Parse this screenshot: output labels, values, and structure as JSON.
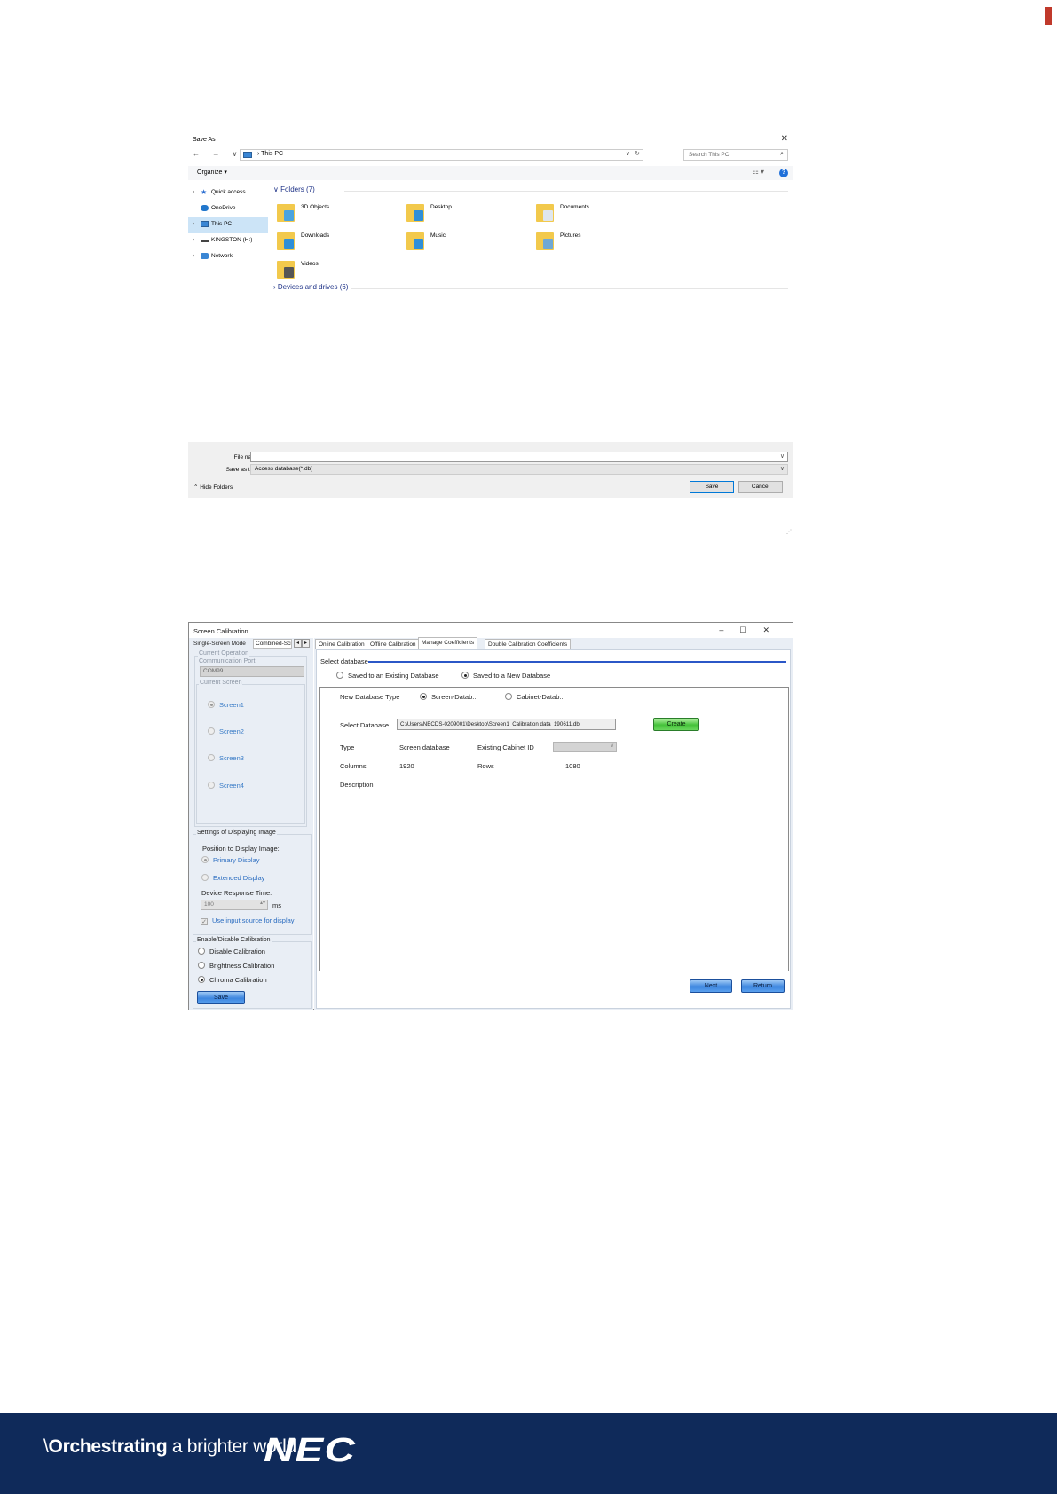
{
  "saveas": {
    "title": "Save As",
    "close_glyph": "✕",
    "nav_glyphs": "← → ∨ ↑",
    "address": {
      "crumb": "› This PC",
      "dropdown": "∨",
      "refresh": "↻"
    },
    "search_placeholder": "Search This PC",
    "search_glyph": "⌕",
    "toolbar": {
      "organize": "Organize ▾",
      "view": "☷ ▾",
      "help": "?"
    },
    "sidebar": [
      {
        "label": "Quick access",
        "icon": "star-icon",
        "chev": "›",
        "selected": false
      },
      {
        "label": "OneDrive",
        "icon": "cloud-icon",
        "chev": "",
        "selected": false
      },
      {
        "label": "This PC",
        "icon": "computer-icon",
        "chev": "›",
        "selected": true
      },
      {
        "label": "KINGSTON (H:)",
        "icon": "usb-drive-icon",
        "chev": "›",
        "selected": false
      },
      {
        "label": "Network",
        "icon": "network-icon",
        "chev": "›",
        "selected": false
      }
    ],
    "folders_header": "∨ Folders (7)",
    "folders": [
      {
        "label": "3D Objects",
        "overlay": "#4aa3df"
      },
      {
        "label": "Desktop",
        "overlay": "#2f8fd8"
      },
      {
        "label": "Documents",
        "overlay": "#dfe6ee"
      },
      {
        "label": "Downloads",
        "overlay": "#2f8fd8"
      },
      {
        "label": "Music",
        "overlay": "#2f8fd8"
      },
      {
        "label": "Pictures",
        "overlay": "#6fa8d6"
      },
      {
        "label": "Videos",
        "overlay": "#555555"
      }
    ],
    "drives_header": "› Devices and drives (6)",
    "file_name_label": "File name:",
    "file_name_value": "",
    "save_type_label": "Save as type:",
    "save_type_value": "Access database(*.db)",
    "dropdown_glyph": "∨",
    "hide_folders": "⌃ Hide Folders",
    "save_button": "Save",
    "cancel_button": "Cancel"
  },
  "calibration": {
    "title": "Screen Calibration",
    "window_buttons": "–☐✕",
    "mode_tabs": [
      "Single-Screen Mode",
      "Combined-Screen Mode"
    ],
    "mode_arrows": [
      "◂",
      "▸"
    ],
    "current_operation": {
      "group": "Current Operation",
      "port_label": "Communication Port",
      "port_value": "COM99"
    },
    "current_screen": {
      "group": "Current Screen",
      "screens": [
        "Screen1",
        "Screen2",
        "Screen3",
        "Screen4"
      ]
    },
    "display_settings": {
      "group": "Settings of Displaying Image",
      "position_label": "Position to Display Image:",
      "primary": "Primary Display",
      "extended": "Extended Display",
      "response_label": "Device Response Time:",
      "response_value": "100",
      "response_spin": "▴▾",
      "response_unit": "ms",
      "input_source": "Use input source for display",
      "input_source_check": "✓"
    },
    "enable_disable": {
      "group": "Enable/Disable Calibration",
      "options": [
        "Disable Calibration",
        "Brightness Calibration",
        "Chroma Calibration"
      ],
      "selected_index": 2,
      "save_button": "Save"
    },
    "tabs": [
      "Online Calibration",
      "Offline Calibration",
      "Manage Coefficients",
      "Double Calibration Coefficients"
    ],
    "active_tab": 2,
    "select_database": {
      "title": "Select database",
      "existing": "Saved to an Existing Database",
      "new": "Saved to a New Database"
    },
    "new_db": {
      "type_label": "New Database Type",
      "screen_option": "Screen-Datab...",
      "cabinet_option": "Cabinet-Datab...",
      "select_label": "Select Database",
      "path": "C:\\Users\\NECDS-0209001\\Desktop\\Screen1_Calibration data_190611.db",
      "create_button": "Create",
      "type_key": "Type",
      "type_value": "Screen database",
      "cabinet_id_label": "Existing Cabinet ID",
      "cabinet_combo_glyph": "∨",
      "columns_label": "Columns",
      "columns_value": "1920",
      "rows_label": "Rows",
      "rows_value": "1080",
      "description_label": "Description"
    },
    "next_button": "Next",
    "return_button": "Return"
  },
  "footer": {
    "tagline_prefix": "\\",
    "tagline_bold": "Orchestrating",
    "tagline_rest": " a brighter world",
    "logo": "NEC"
  }
}
